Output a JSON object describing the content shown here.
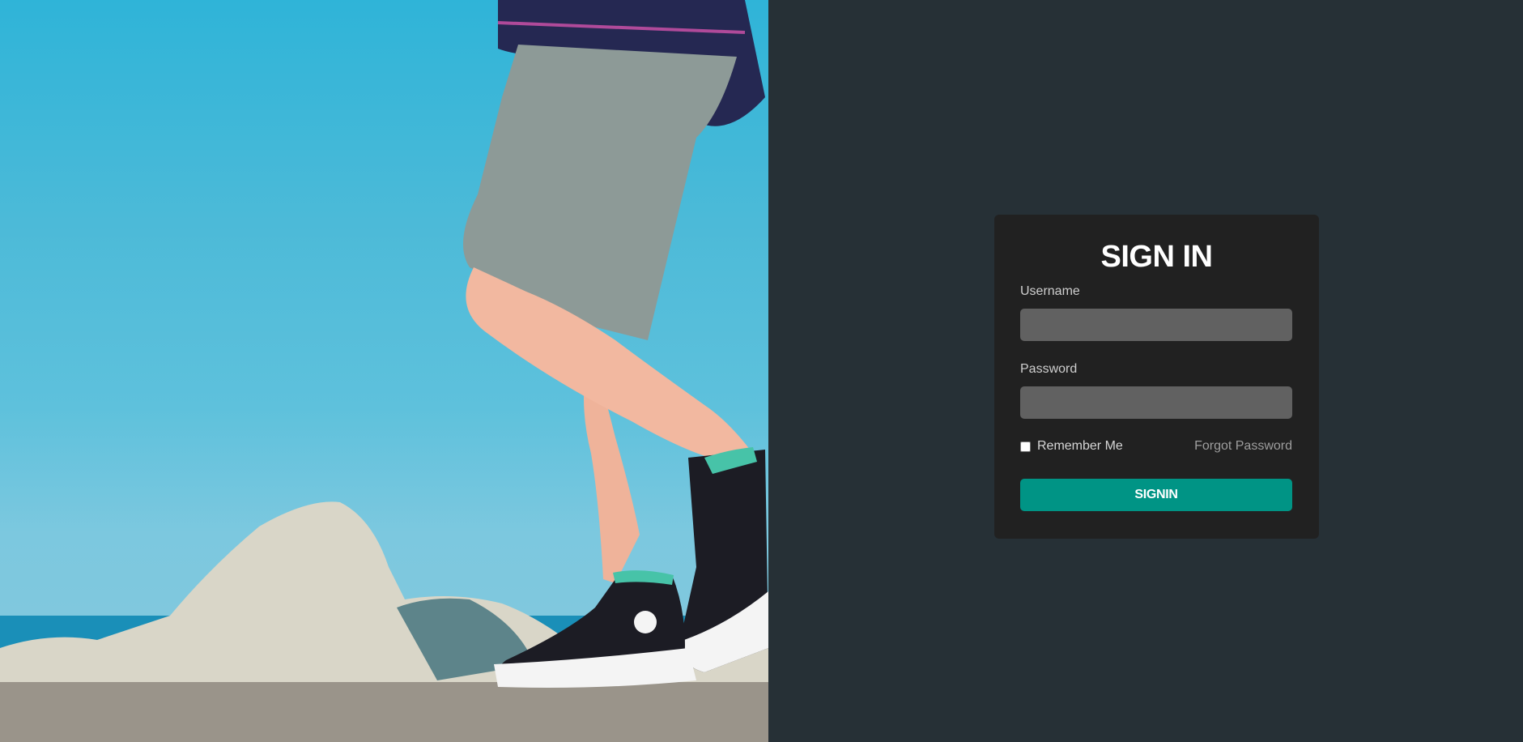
{
  "hero": {
    "image_icon": "photo-sneakers-on-rocks"
  },
  "login": {
    "title": "SIGN IN",
    "username_label": "Username",
    "username_value": "",
    "password_label": "Password",
    "password_value": "",
    "remember_label": "Remember Me",
    "remember_checked": false,
    "forgot_label": "Forgot Password",
    "submit_label": "SIGNIN"
  },
  "colors": {
    "page_background": "#263036",
    "card_background": "#212121",
    "input_background": "#616161",
    "accent": "#009485"
  }
}
